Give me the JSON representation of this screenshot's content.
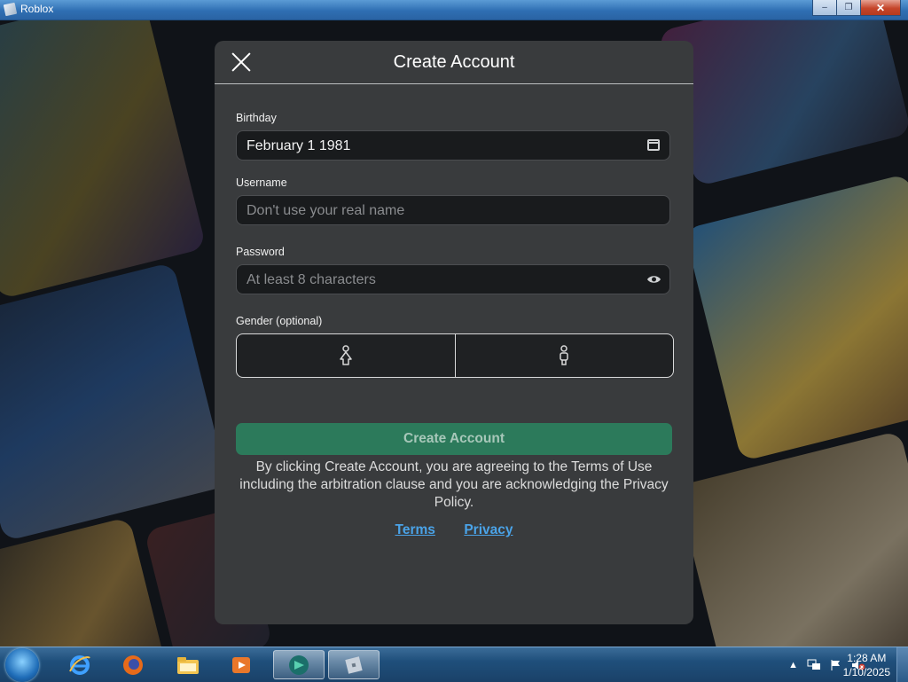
{
  "window": {
    "title": "Roblox"
  },
  "dialog": {
    "title": "Create Account",
    "birthday": {
      "label": "Birthday",
      "value": "February 1 1981"
    },
    "username": {
      "label": "Username",
      "placeholder": "Don't use your real name"
    },
    "password": {
      "label": "Password",
      "placeholder": "At least 8 characters"
    },
    "gender": {
      "label": "Gender (optional)"
    },
    "submit_label": "Create Account",
    "legal_text": "By clicking Create Account, you are agreeing to the Terms of Use including the arbitration clause and you are acknowledging the Privacy Policy.",
    "links": {
      "terms": "Terms",
      "privacy": "Privacy"
    }
  },
  "taskbar": {
    "pinned": [
      "internet-explorer-icon",
      "firefox-icon",
      "file-explorer-icon",
      "media-player-icon",
      "remote-app-icon",
      "roblox-icon"
    ],
    "clock": {
      "time": "1:28 AM",
      "date": "1/10/2025"
    }
  },
  "colors": {
    "dialog_bg": "#393b3d",
    "field_bg": "#191b1d",
    "button_green": "#2c7a5b",
    "link_blue": "#4aa3e8"
  }
}
